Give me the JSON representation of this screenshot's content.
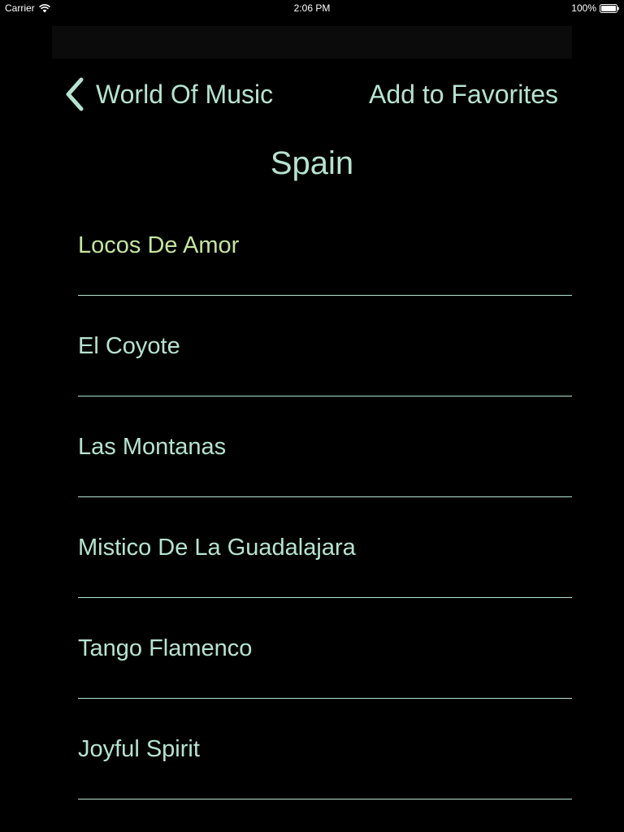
{
  "status_bar": {
    "carrier": "Carrier",
    "time": "2:06 PM",
    "battery": "100%",
    "wifi_icon": "wifi-icon",
    "battery_icon": "battery-icon"
  },
  "nav": {
    "back_label": "World Of Music",
    "back_icon": "chevron-left-icon",
    "right_label": "Add to Favorites"
  },
  "page_title": "Spain",
  "songs": [
    {
      "title": "Locos De Amor",
      "selected": true
    },
    {
      "title": "El Coyote",
      "selected": false
    },
    {
      "title": "Las Montanas",
      "selected": false
    },
    {
      "title": "Mistico De La Guadalajara",
      "selected": false
    },
    {
      "title": "Tango Flamenco",
      "selected": false
    },
    {
      "title": "Joyful Spirit",
      "selected": false
    }
  ],
  "colors": {
    "background": "#000000",
    "accent": "#b6e3d0",
    "selected": "#c3e6a0",
    "separator": "#b6e3d0"
  }
}
